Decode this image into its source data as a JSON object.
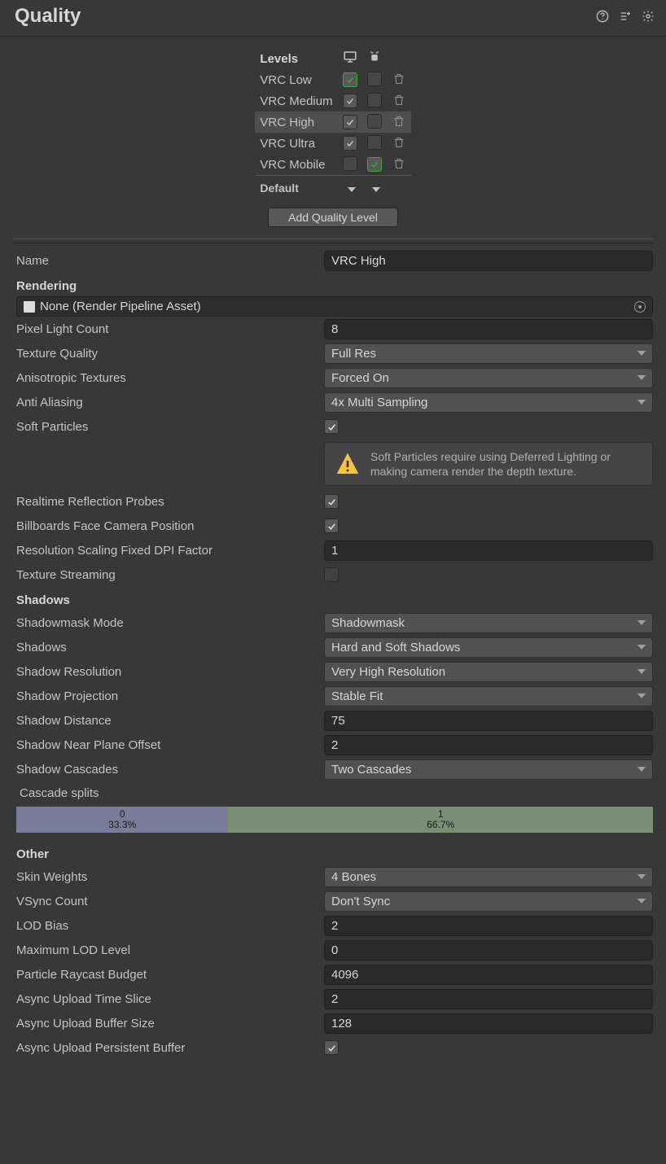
{
  "header": {
    "title": "Quality"
  },
  "levels": {
    "header": "Levels",
    "items": [
      {
        "name": "VRC Low",
        "desktop": true,
        "desktop_default": true,
        "mobile": false,
        "mobile_default": false
      },
      {
        "name": "VRC Medium",
        "desktop": true,
        "desktop_default": false,
        "mobile": false,
        "mobile_default": false
      },
      {
        "name": "VRC High",
        "desktop": true,
        "desktop_default": false,
        "mobile": false,
        "mobile_default": false,
        "selected": true
      },
      {
        "name": "VRC Ultra",
        "desktop": true,
        "desktop_default": false,
        "mobile": false,
        "mobile_default": false
      },
      {
        "name": "VRC Mobile",
        "desktop": false,
        "desktop_default": false,
        "mobile": true,
        "mobile_default": true
      }
    ],
    "default_label": "Default",
    "add_button": "Add Quality Level"
  },
  "name": {
    "label": "Name",
    "value": "VRC High"
  },
  "rendering": {
    "title": "Rendering",
    "pipeline_asset": "None (Render Pipeline Asset)",
    "pixel_light": {
      "label": "Pixel Light Count",
      "value": "8"
    },
    "tex_quality": {
      "label": "Texture Quality",
      "value": "Full Res"
    },
    "aniso": {
      "label": "Anisotropic Textures",
      "value": "Forced On"
    },
    "aa": {
      "label": "Anti Aliasing",
      "value": "4x Multi Sampling"
    },
    "soft_particles": {
      "label": "Soft Particles"
    },
    "sp_info": "Soft Particles require using Deferred Lighting or making camera render the depth texture.",
    "reflection": {
      "label": "Realtime Reflection Probes"
    },
    "billboards": {
      "label": "Billboards Face Camera Position"
    },
    "dpi": {
      "label": "Resolution Scaling Fixed DPI Factor",
      "value": "1"
    },
    "tex_stream": {
      "label": "Texture Streaming"
    }
  },
  "shadows": {
    "title": "Shadows",
    "mask": {
      "label": "Shadowmask Mode",
      "value": "Shadowmask"
    },
    "shadows": {
      "label": "Shadows",
      "value": "Hard and Soft Shadows"
    },
    "resolution": {
      "label": "Shadow Resolution",
      "value": "Very High Resolution"
    },
    "projection": {
      "label": "Shadow Projection",
      "value": "Stable Fit"
    },
    "distance": {
      "label": "Shadow Distance",
      "value": "75"
    },
    "near": {
      "label": "Shadow Near Plane Offset",
      "value": "2"
    },
    "cascades": {
      "label": "Shadow Cascades",
      "value": "Two Cascades"
    },
    "splits_label": "Cascade splits",
    "splits": [
      {
        "idx": "0",
        "pct": "33.3%",
        "width": 33.3
      },
      {
        "idx": "1",
        "pct": "66.7%",
        "width": 66.7
      }
    ]
  },
  "other": {
    "title": "Other",
    "skin": {
      "label": "Skin Weights",
      "value": "4 Bones"
    },
    "vsync": {
      "label": "VSync Count",
      "value": "Don't Sync"
    },
    "lod": {
      "label": "LOD Bias",
      "value": "2"
    },
    "maxlod": {
      "label": "Maximum LOD Level",
      "value": "0"
    },
    "raycast": {
      "label": "Particle Raycast Budget",
      "value": "4096"
    },
    "async_time": {
      "label": "Async Upload Time Slice",
      "value": "2"
    },
    "async_buf": {
      "label": "Async Upload Buffer Size",
      "value": "128"
    },
    "async_persist": {
      "label": "Async Upload Persistent Buffer"
    }
  }
}
